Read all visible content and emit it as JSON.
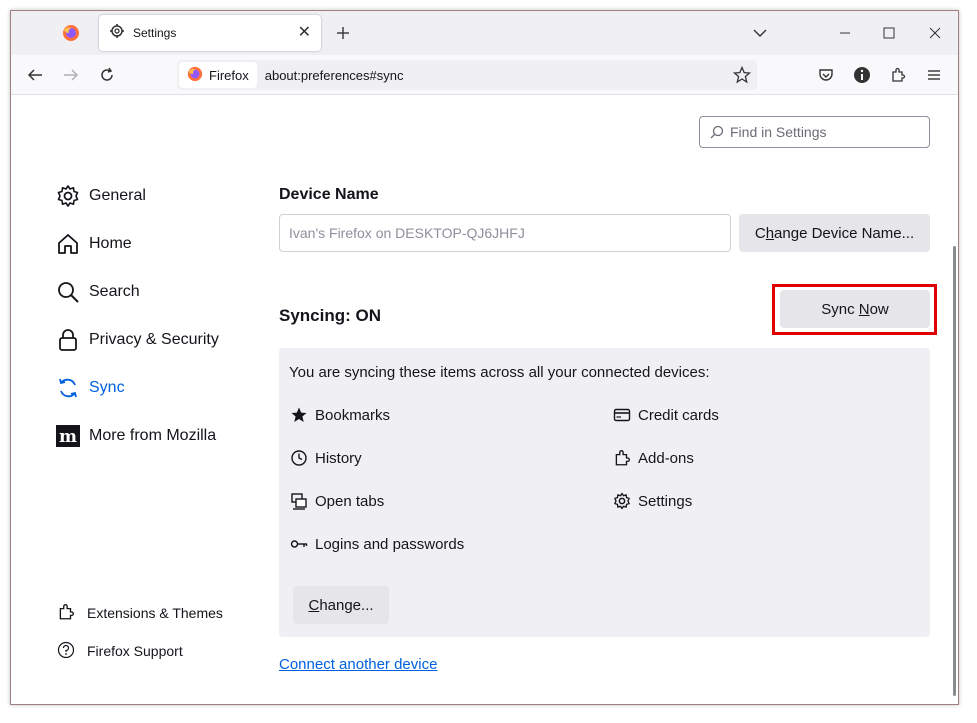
{
  "tab": {
    "title": "Settings"
  },
  "urlbar": {
    "identity": "Firefox",
    "url": "about:preferences#sync"
  },
  "find": {
    "placeholder": "Find in Settings"
  },
  "sidebar": {
    "items": [
      {
        "label": "General",
        "icon": "gear-icon"
      },
      {
        "label": "Home",
        "icon": "home-icon"
      },
      {
        "label": "Search",
        "icon": "search-icon"
      },
      {
        "label": "Privacy & Security",
        "icon": "lock-icon"
      },
      {
        "label": "Sync",
        "icon": "sync-icon",
        "active": true
      },
      {
        "label": "More from Mozilla",
        "icon": "mozilla-icon"
      }
    ],
    "footer": [
      {
        "label": "Extensions & Themes",
        "icon": "puzzle-icon"
      },
      {
        "label": "Firefox Support",
        "icon": "help-icon"
      }
    ]
  },
  "sync": {
    "device_heading": "Device Name",
    "device_name": "Ivan's Firefox on DESKTOP-QJ6JHFJ",
    "change_device_pre": "C",
    "change_device_key": "h",
    "change_device_post": "ange Device Name...",
    "status": "Syncing: ON",
    "sync_now_pre": "Sync ",
    "sync_now_key": "N",
    "sync_now_post": "ow",
    "description": "You are syncing these items across all your connected devices:",
    "engines_left": [
      "Bookmarks",
      "History",
      "Open tabs",
      "Logins and passwords"
    ],
    "engines_right": [
      "Credit cards",
      "Add-ons",
      "Settings"
    ],
    "change_key": "C",
    "change_post": "hange...",
    "connect_link": "Connect another device"
  },
  "colors": {
    "accent": "#0061e0",
    "highlight": "#e00000",
    "panel": "#f0f0f4"
  }
}
